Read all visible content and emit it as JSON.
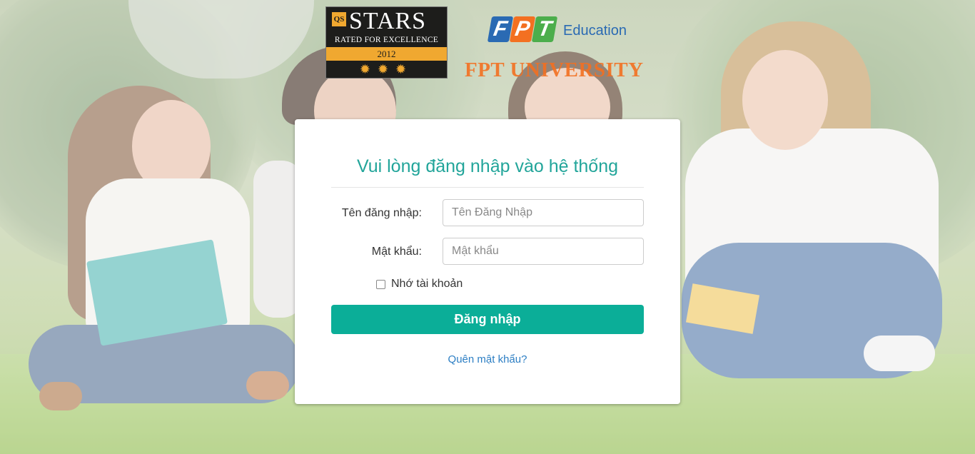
{
  "logos": {
    "qs": {
      "badge": "QS",
      "title": "STARS",
      "subtitle": "RATED FOR EXCELLENCE",
      "year": "2012",
      "medals": "✹✹✹"
    },
    "fpt": {
      "letters": [
        "F",
        "P",
        "T"
      ],
      "education": "Education",
      "university": "FPT UNIVERSITY"
    }
  },
  "login": {
    "title": "Vui lòng đăng nhập vào hệ thống",
    "username_label": "Tên đăng nhập:",
    "username_placeholder": "Tên Đăng Nhập",
    "password_label": "Mật khẩu:",
    "password_placeholder": "Mật khẩu",
    "remember_label": "Nhớ tài khoản",
    "submit_label": "Đăng nhập",
    "forgot_link": "Quên mật khẩu?"
  },
  "colors": {
    "accent": "#0bae98",
    "title": "#22a59a",
    "link": "#2d7fc4",
    "fpt_orange": "#f37021",
    "fpt_blue": "#2a6ab3",
    "fpt_green": "#4cae4c"
  }
}
